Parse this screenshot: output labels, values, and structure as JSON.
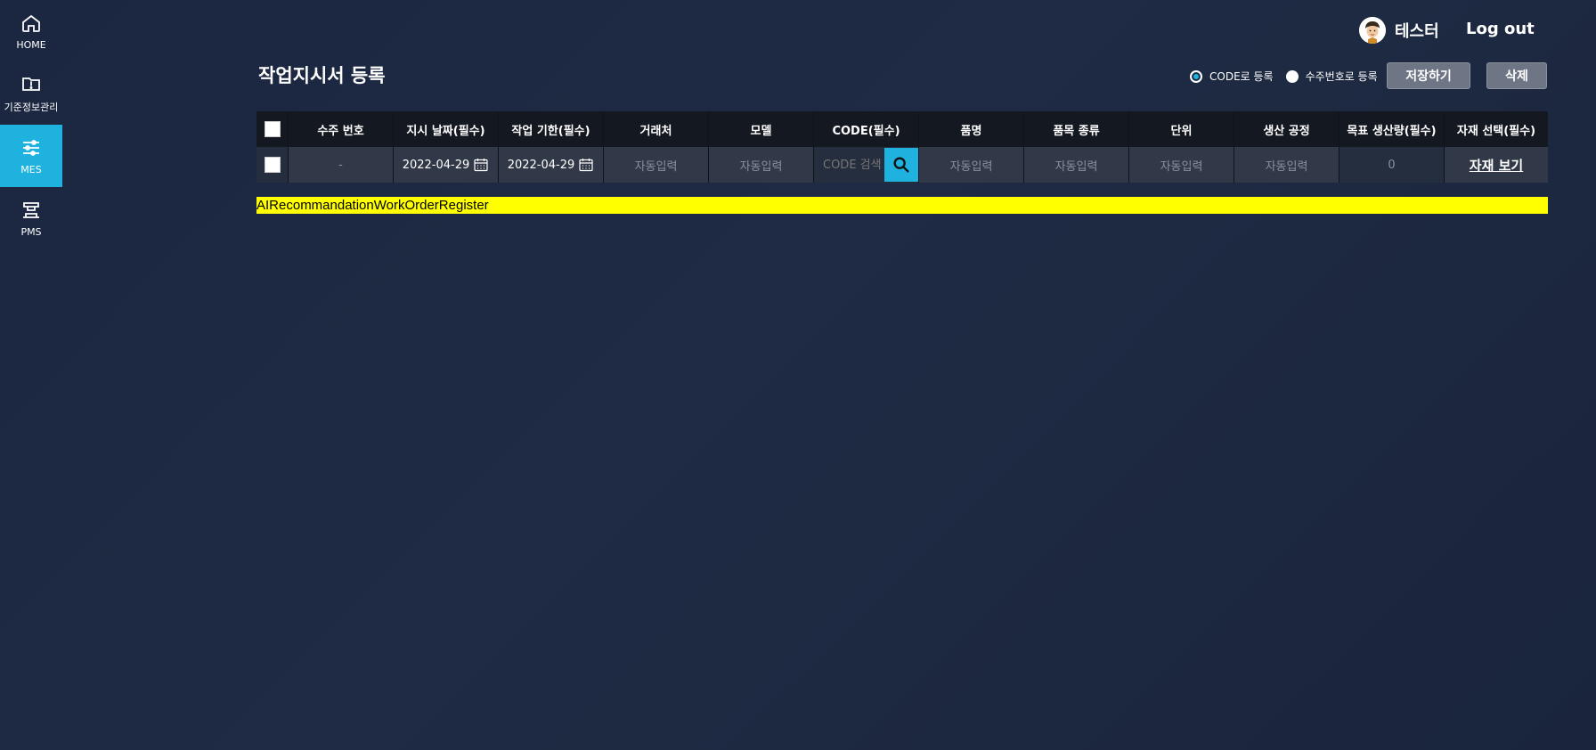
{
  "sidebar": {
    "items": [
      {
        "label": "HOME",
        "icon": "home-icon"
      },
      {
        "label": "기준정보관리",
        "icon": "folder-alert-icon"
      },
      {
        "label": "MES",
        "icon": "sliders-icon",
        "active": true
      },
      {
        "label": "PMS",
        "icon": "press-machine-icon"
      }
    ]
  },
  "header": {
    "user_name": "테스터",
    "logout_label": "Log out"
  },
  "page": {
    "title": "작업지시서 등록",
    "radio_code": "CODE로 등록",
    "radio_order": "수주번호로 등록",
    "save_label": "저장하기",
    "delete_label": "삭제"
  },
  "table": {
    "headers": [
      "수주 번호",
      "지시 날짜(필수)",
      "작업 기한(필수)",
      "거래처",
      "모델",
      "CODE(필수)",
      "품명",
      "품목 종류",
      "단위",
      "생산 공정",
      "목표 생산량(필수)",
      "자재 선택(필수)"
    ],
    "row": {
      "order_no": "-",
      "instruct_date": "2022-04-29",
      "deadline": "2022-04-29",
      "client": "자동입력",
      "model": "자동입력",
      "code_placeholder": "CODE 검색",
      "item_name": "자동입력",
      "item_type": "자동입력",
      "unit": "자동입력",
      "process": "자동입력",
      "target_qty": "0",
      "material_link": "자재 보기"
    }
  },
  "banner_text": "AIRecommandationWorkOrderRegister",
  "colors": {
    "accent": "#1fb2de",
    "banner": "#ffff00"
  }
}
